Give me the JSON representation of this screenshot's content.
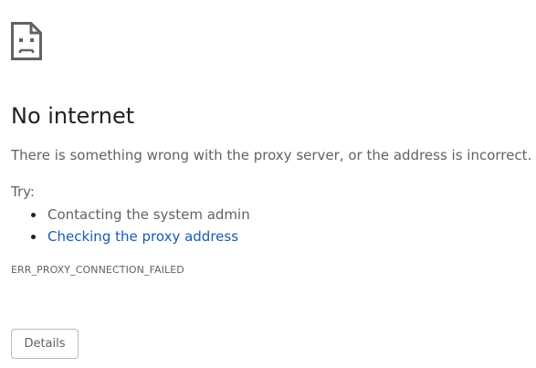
{
  "icon": "sad-page-icon",
  "title": "No internet",
  "description": "There is something wrong with the proxy server, or the address is incorrect.",
  "try_label": "Try:",
  "suggestions": [
    {
      "label": "Contacting the system admin",
      "link": false
    },
    {
      "label": "Checking the proxy address",
      "link": true
    }
  ],
  "error_code": "ERR_PROXY_CONNECTION_FAILED",
  "details_button": "Details",
  "colors": {
    "text": "#202124",
    "secondary_text": "#5f6368",
    "link": "#1a5bb4",
    "button_border": "#b8bcc1"
  }
}
